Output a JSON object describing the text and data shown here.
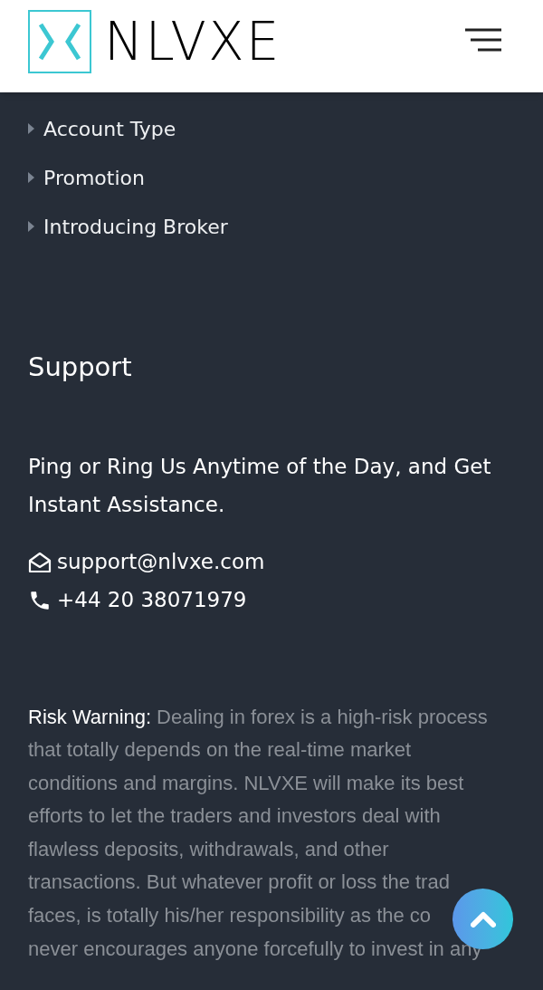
{
  "header": {
    "logo": "NLVXE"
  },
  "links": [
    {
      "label": "Account Type"
    },
    {
      "label": "Promotion"
    },
    {
      "label": "Introducing Broker"
    }
  ],
  "support": {
    "title": "Support",
    "tagline": "Ping or Ring Us Anytime of the Day, and Get Instant Assistance.",
    "email": "support@nlvxe.com",
    "phone": "+44 20 38071979"
  },
  "risk_warning": {
    "label": "Risk Warning:",
    "lines": [
      "Dealing in forex is a high-risk process",
      "that totally depends on the real-time market",
      "conditions and margins. NLVXE will make its best",
      "efforts to let the traders and investors deal with",
      "flawless deposits, withdrawals, and other",
      "transactions. But whatever profit or loss the trad",
      "faces, is totally his/her responsibility as the co",
      "never encourages anyone forcefully to invest in any"
    ]
  }
}
